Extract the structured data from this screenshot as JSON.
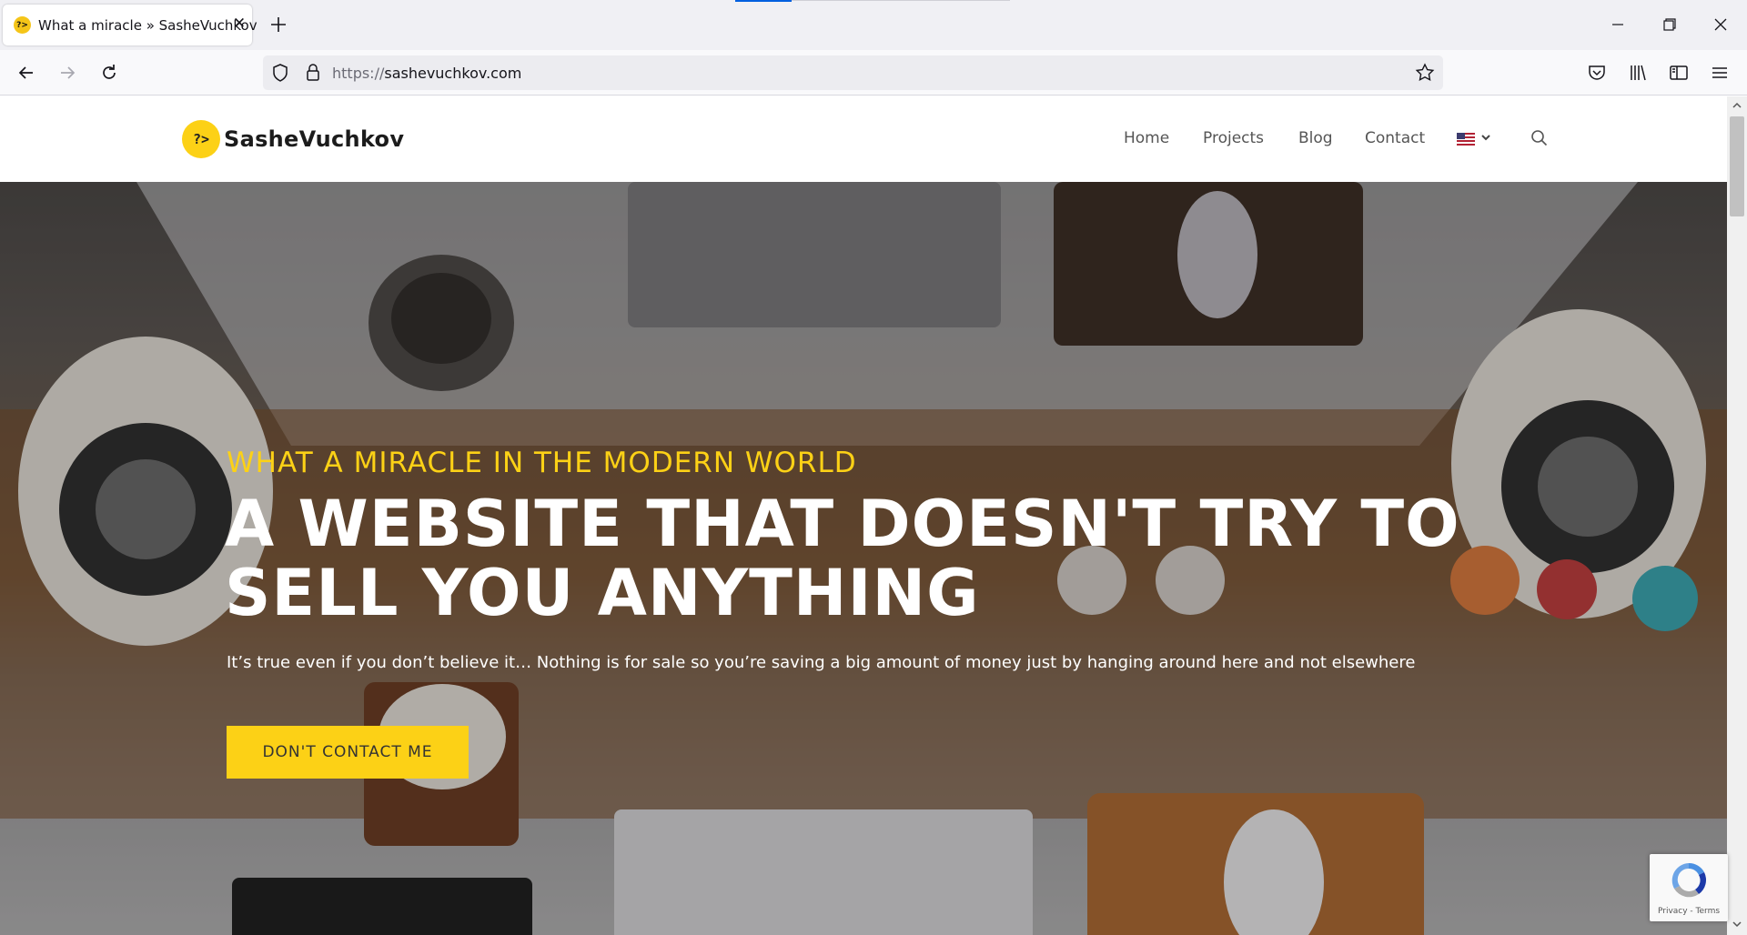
{
  "browser": {
    "tab": {
      "title": "What a miracle » SasheVuchkov",
      "favicon_text": "?>",
      "close_glyph": "✕"
    },
    "url": {
      "protocol": "https://",
      "host": "sashevuchkov.com"
    },
    "icons": [
      "back-icon",
      "forward-icon",
      "reload-icon",
      "shield-icon",
      "lock-icon",
      "bookmark-star-icon",
      "pocket-icon",
      "library-icon",
      "sidebar-icon",
      "menu-icon",
      "new-tab-icon",
      "minimize-icon",
      "restore-icon",
      "close-icon"
    ]
  },
  "site": {
    "logo": {
      "badge": "?>",
      "name": "SasheVuchkov"
    },
    "menu": [
      "Home",
      "Projects",
      "Blog",
      "Contact"
    ],
    "language": {
      "flag": "us-flag-icon"
    },
    "search_icon": "search-icon"
  },
  "hero": {
    "kicker": "WHAT A MIRACLE IN THE MODERN WORLD",
    "title_line1": "A WEBSITE THAT DOESN'T TRY TO",
    "title_line2": "SELL YOU ANYTHING",
    "description": "It’s true even if you don’t believe it… Nothing is for sale so you’re saving a big amount of money just by hanging around here and not elsewhere",
    "cta": "DON'T CONTACT ME"
  },
  "recaptcha": {
    "links": "Privacy - Terms"
  },
  "colors": {
    "accent": "#fcd116",
    "header_bg": "#ffffff",
    "menu_text": "#555555",
    "browser_chrome": "#f0f0f4"
  }
}
